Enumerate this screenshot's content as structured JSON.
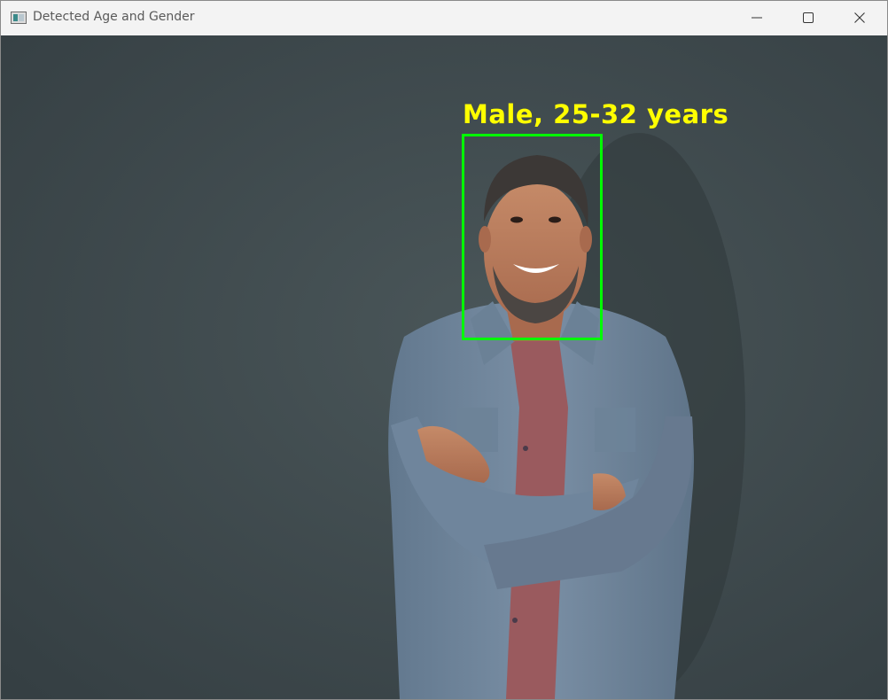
{
  "window": {
    "title": "Detected Age and Gender",
    "icon": "opencv-window-icon",
    "controls": {
      "minimize_icon": "minimize-icon",
      "maximize_icon": "maximize-icon",
      "close_icon": "close-icon"
    }
  },
  "detection": {
    "label": "Male, 25-32 years",
    "label_color": "#ffff00",
    "box_color": "#00ff00"
  },
  "colors": {
    "wall": "#3f4a4e",
    "shirt": "#6f859c",
    "tshirt": "#9a5a5e",
    "skin": "#b9785a"
  }
}
